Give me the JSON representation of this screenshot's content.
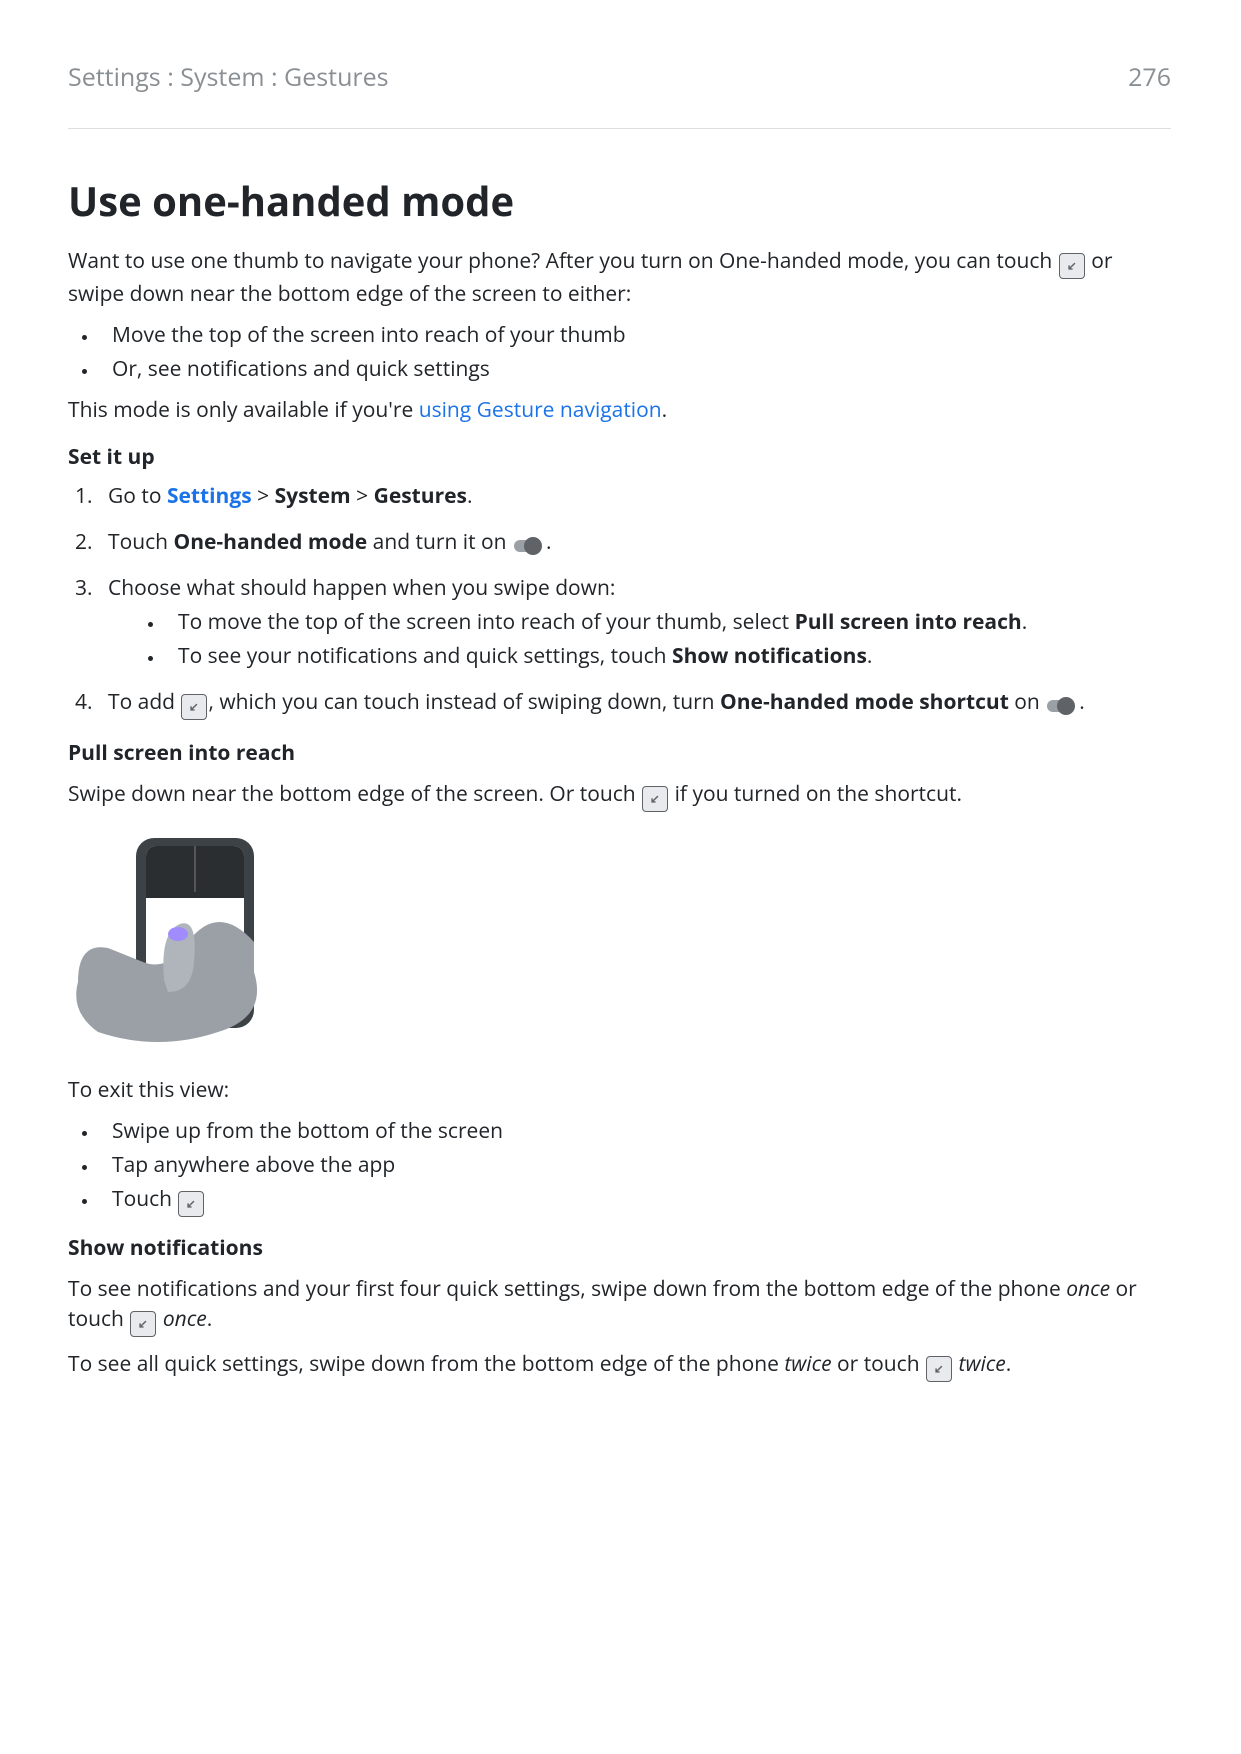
{
  "header": {
    "breadcrumb": "Settings : System : Gestures",
    "page_number": "276"
  },
  "title": "Use one-handed mode",
  "intro": {
    "t1": "Want to use one thumb to navigate your phone? After you turn on One-handed mode, you can touch ",
    "t2": " or swipe down near the bottom edge of the screen to either:"
  },
  "intro_bullets": [
    "Move the top of the screen into reach of your thumb",
    "Or, see notifications and quick settings"
  ],
  "availability": {
    "t1": "This mode is only available if you're ",
    "link": "using Gesture navigation",
    "t2": "."
  },
  "setup_heading": "Set it up",
  "steps": {
    "s1": {
      "t1": "Go to ",
      "link": "Settings",
      "sep1": " > ",
      "b1": "System",
      "sep2": " > ",
      "b2": "Gestures",
      "t2": "."
    },
    "s2": {
      "t1": "Touch ",
      "b1": "One-handed mode",
      "t2": " and turn it on ",
      "t3": "."
    },
    "s3": {
      "main": "Choose what should happen when you swipe down:",
      "sub1": {
        "t1": "To move the top of the screen into reach of your thumb, select ",
        "b": "Pull screen into reach",
        "t2": "."
      },
      "sub2": {
        "t1": "To see your notifications and quick settings, touch ",
        "b": "Show notifications",
        "t2": "."
      }
    },
    "s4": {
      "t1": "To add ",
      "t2": ", which you can touch instead of swiping down, turn ",
      "b": "One-handed mode shortcut",
      "t3": " on ",
      "t4": "."
    }
  },
  "pull_heading": "Pull screen into reach",
  "pull_line": {
    "t1": "Swipe down near the bottom edge of the screen. Or touch ",
    "t2": " if you turned on the shortcut."
  },
  "exit_intro": "To exit this view:",
  "exit_bullets": {
    "b1": "Swipe up from the bottom of the screen",
    "b2": "Tap anywhere above the app",
    "b3": "Touch "
  },
  "show_heading": "Show notifications",
  "show_p1": {
    "t1": "To see notifications and your first four quick settings, swipe down from the bottom edge of the phone ",
    "e1": "once",
    "t2": " or touch ",
    "e2": "once",
    "t3": "."
  },
  "show_p2": {
    "t1": "To see all quick settings, swipe down from the bottom edge of the phone ",
    "e1": "twice",
    "t2": " or touch ",
    "e2": "twice",
    "t3": "."
  }
}
